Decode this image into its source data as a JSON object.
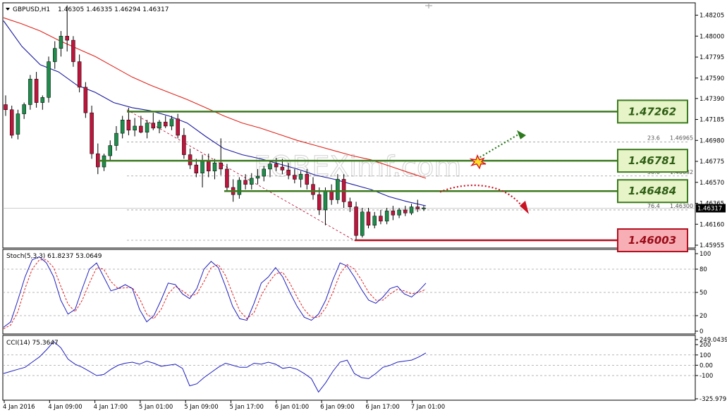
{
  "header": {
    "symbol": "GBPUSD,H1",
    "ohlc": "1.46305 1.46335 1.46294 1.46317"
  },
  "watermark": "FOREXimf.com",
  "colors": {
    "bull": "#1e8c4a",
    "bear": "#c0143c",
    "ma_fast": "#1a1aa0",
    "ma_slow": "#e0241c",
    "level_green_border": "#3c7a1e",
    "level_green_fill": "#e6f4c8",
    "level_red_border": "#b01020",
    "level_red_fill": "#f7aeb4",
    "stoch_main": "#2020c0",
    "stoch_signal": "#e02020",
    "cci": "#2020c0"
  },
  "chart_data": [
    {
      "type": "candlestick",
      "title": "GBPUSD,H1",
      "ylim": [
        1.45955,
        1.4825
      ],
      "price_ticks": [
        "1.48205",
        "1.48000",
        "1.47795",
        "1.47590",
        "1.47390",
        "1.47185",
        "1.46980",
        "1.46775",
        "1.46570",
        "1.46365",
        "1.46160",
        "1.45955"
      ],
      "current_price": "1.46317",
      "x_ticks": [
        "4 Jan 2016",
        "4 Jan 09:00",
        "4 Jan 17:00",
        "5 Jan 01:00",
        "5 Jan 09:00",
        "5 Jan 17:00",
        "6 Jan 01:00",
        "6 Jan 09:00",
        "6 Jan 17:00",
        "7 Jan 01:00"
      ],
      "candles": [
        [
          1.4733,
          1.4742,
          1.4722,
          1.4728
        ],
        [
          1.4728,
          1.4732,
          1.47,
          1.4703
        ],
        [
          1.4704,
          1.4728,
          1.4699,
          1.4724
        ],
        [
          1.4724,
          1.4735,
          1.4719,
          1.4733
        ],
        [
          1.4733,
          1.4762,
          1.4728,
          1.4758
        ],
        [
          1.4758,
          1.4765,
          1.473,
          1.4735
        ],
        [
          1.4735,
          1.4742,
          1.4728,
          1.474
        ],
        [
          1.474,
          1.478,
          1.4735,
          1.4775
        ],
        [
          1.4775,
          1.4795,
          1.4768,
          1.4788
        ],
        [
          1.4788,
          1.4805,
          1.478,
          1.48
        ],
        [
          1.48,
          1.483,
          1.4785,
          1.4796
        ],
        [
          1.4796,
          1.48,
          1.477,
          1.4775
        ],
        [
          1.4775,
          1.4782,
          1.4745,
          1.475
        ],
        [
          1.475,
          1.4755,
          1.472,
          1.4725
        ],
        [
          1.4725,
          1.4732,
          1.468,
          1.4685
        ],
        [
          1.4685,
          1.4695,
          1.4665,
          1.4672
        ],
        [
          1.4672,
          1.4685,
          1.4668,
          1.4683
        ],
        [
          1.4683,
          1.4698,
          1.4678,
          1.4693
        ],
        [
          1.4693,
          1.4712,
          1.4688,
          1.4705
        ],
        [
          1.4705,
          1.4722,
          1.47,
          1.4718
        ],
        [
          1.4718,
          1.473,
          1.4703,
          1.4708
        ],
        [
          1.4708,
          1.472,
          1.4702,
          1.4712
        ],
        [
          1.4712,
          1.4722,
          1.4705,
          1.4706
        ],
        [
          1.4706,
          1.4718,
          1.47,
          1.4715
        ],
        [
          1.4715,
          1.4725,
          1.4708,
          1.471
        ],
        [
          1.471,
          1.4718,
          1.4705,
          1.4716
        ],
        [
          1.4716,
          1.4722,
          1.471,
          1.4712
        ],
        [
          1.4712,
          1.4722,
          1.4708,
          1.4719
        ],
        [
          1.4719,
          1.4724,
          1.47,
          1.4703
        ],
        [
          1.4703,
          1.471,
          1.468,
          1.4684
        ],
        [
          1.4684,
          1.469,
          1.467,
          1.4674
        ],
        [
          1.4674,
          1.468,
          1.4662,
          1.4666
        ],
        [
          1.4666,
          1.4684,
          1.4652,
          1.4678
        ],
        [
          1.4678,
          1.4685,
          1.4662,
          1.4668
        ],
        [
          1.4668,
          1.468,
          1.466,
          1.4676
        ],
        [
          1.4676,
          1.47,
          1.4664,
          1.467
        ],
        [
          1.467,
          1.4675,
          1.4648,
          1.4652
        ],
        [
          1.4652,
          1.466,
          1.4638,
          1.4645
        ],
        [
          1.4645,
          1.4662,
          1.4641,
          1.4659
        ],
        [
          1.4659,
          1.4665,
          1.465,
          1.4655
        ],
        [
          1.4655,
          1.4666,
          1.465,
          1.4661
        ],
        [
          1.4661,
          1.467,
          1.4655,
          1.4663
        ],
        [
          1.4663,
          1.4673,
          1.4658,
          1.467
        ],
        [
          1.467,
          1.4678,
          1.4662,
          1.4675
        ],
        [
          1.4675,
          1.4681,
          1.4668,
          1.4672
        ],
        [
          1.4672,
          1.468,
          1.4665,
          1.4669
        ],
        [
          1.4669,
          1.4676,
          1.466,
          1.4664
        ],
        [
          1.4664,
          1.467,
          1.4656,
          1.466
        ],
        [
          1.466,
          1.4668,
          1.4652,
          1.4665
        ],
        [
          1.4665,
          1.467,
          1.465,
          1.4655
        ],
        [
          1.4655,
          1.4662,
          1.464,
          1.4645
        ],
        [
          1.4645,
          1.4652,
          1.4625,
          1.463
        ],
        [
          1.463,
          1.4652,
          1.4615,
          1.4648
        ],
        [
          1.4648,
          1.4655,
          1.4635,
          1.464
        ],
        [
          1.464,
          1.4665,
          1.4636,
          1.466
        ],
        [
          1.466,
          1.4665,
          1.4632,
          1.4638
        ],
        [
          1.4638,
          1.4642,
          1.4628,
          1.4633
        ],
        [
          1.4633,
          1.4638,
          1.46,
          1.4605
        ],
        [
          1.4605,
          1.4632,
          1.4603,
          1.4628
        ],
        [
          1.4628,
          1.4632,
          1.4612,
          1.4615
        ],
        [
          1.4615,
          1.4628,
          1.4612,
          1.4624
        ],
        [
          1.4624,
          1.463,
          1.4616,
          1.4619
        ],
        [
          1.4619,
          1.4632,
          1.4616,
          1.4629
        ],
        [
          1.4629,
          1.4634,
          1.462,
          1.4625
        ],
        [
          1.4625,
          1.4632,
          1.4622,
          1.463
        ],
        [
          1.463,
          1.4634,
          1.4624,
          1.4627
        ],
        [
          1.4627,
          1.4636,
          1.4625,
          1.4633
        ],
        [
          1.4633,
          1.464,
          1.4628,
          1.4631
        ],
        [
          1.4631,
          1.4634,
          1.4629,
          1.4632
        ]
      ],
      "ma_fast_anchors": [
        1.4815,
        1.479,
        1.4772,
        1.4765,
        1.4752,
        1.4745,
        1.4735,
        1.473,
        1.4727,
        1.4722,
        1.4715,
        1.4702,
        1.469,
        1.4684,
        1.468,
        1.4675,
        1.467,
        1.4664,
        1.466,
        1.4655,
        1.465,
        1.4643,
        1.4638,
        1.4634
      ],
      "ma_slow_anchors": [
        1.4818,
        1.4812,
        1.4805,
        1.4796,
        1.4788,
        1.478,
        1.477,
        1.476,
        1.4752,
        1.4745,
        1.4738,
        1.473,
        1.4722,
        1.4715,
        1.471,
        1.4704,
        1.4698,
        1.4693,
        1.4688,
        1.4683,
        1.4679,
        1.4673,
        1.4667,
        1.4661
      ],
      "levels": [
        {
          "label": "1.47262",
          "value": 1.47262,
          "style": "green"
        },
        {
          "label": "1.46781",
          "value": 1.46781,
          "style": "green"
        },
        {
          "label": "1.46484",
          "value": 1.46484,
          "style": "green"
        },
        {
          "label": "1.46003",
          "value": 1.46003,
          "style": "red"
        }
      ],
      "fib_levels": [
        {
          "ratio": "23.6",
          "price": "1.46965"
        },
        {
          "ratio": "50.0",
          "price": "1.46632"
        },
        {
          "ratio": "76.4",
          "price": "1.46300"
        }
      ]
    },
    {
      "type": "line",
      "title": "Stoch(5,3,3) 61.8237 53.0649",
      "ylim": [
        0,
        100
      ],
      "y_ticks": [
        "100",
        "80",
        "50",
        "20",
        "0"
      ],
      "series": [
        {
          "name": "main",
          "values": [
            5,
            12,
            40,
            70,
            92,
            96,
            88,
            70,
            40,
            22,
            28,
            55,
            80,
            88,
            70,
            52,
            55,
            60,
            55,
            28,
            12,
            20,
            40,
            62,
            60,
            48,
            42,
            55,
            80,
            90,
            82,
            58,
            32,
            16,
            14,
            36,
            62,
            70,
            82,
            70,
            50,
            32,
            18,
            14,
            22,
            40,
            66,
            88,
            84,
            70,
            54,
            40,
            36,
            44,
            55,
            58,
            48,
            44,
            52,
            62
          ]
        },
        {
          "name": "signal",
          "values": [
            3,
            8,
            25,
            55,
            80,
            92,
            92,
            82,
            58,
            35,
            25,
            40,
            62,
            82,
            80,
            64,
            55,
            56,
            56,
            42,
            22,
            16,
            28,
            48,
            58,
            52,
            45,
            48,
            64,
            82,
            86,
            72,
            48,
            26,
            16,
            24,
            46,
            62,
            74,
            76,
            62,
            44,
            28,
            18,
            18,
            30,
            50,
            74,
            86,
            80,
            66,
            50,
            40,
            40,
            48,
            54,
            52,
            48,
            50,
            54
          ]
        }
      ]
    },
    {
      "type": "line",
      "title": "CCI(14) 75.3647",
      "ylim": [
        -325.9797,
        249.0439
      ],
      "y_ticks": [
        "249.0439",
        "200",
        "100",
        "0.00",
        "-100",
        "-325.9797"
      ],
      "series": [
        {
          "name": "CCI(14)",
          "values": [
            -80,
            -60,
            -40,
            -20,
            30,
            80,
            150,
            230,
            170,
            60,
            10,
            -20,
            -60,
            -100,
            -90,
            -40,
            0,
            20,
            30,
            10,
            40,
            20,
            -10,
            0,
            10,
            -30,
            -200,
            -180,
            -120,
            -70,
            -20,
            20,
            0,
            -20,
            -20,
            20,
            10,
            30,
            10,
            -30,
            -20,
            -40,
            -80,
            -130,
            -260,
            -170,
            -60,
            30,
            50,
            -80,
            -120,
            -130,
            -80,
            -20,
            0,
            30,
            40,
            50,
            80,
            120
          ]
        }
      ]
    }
  ]
}
